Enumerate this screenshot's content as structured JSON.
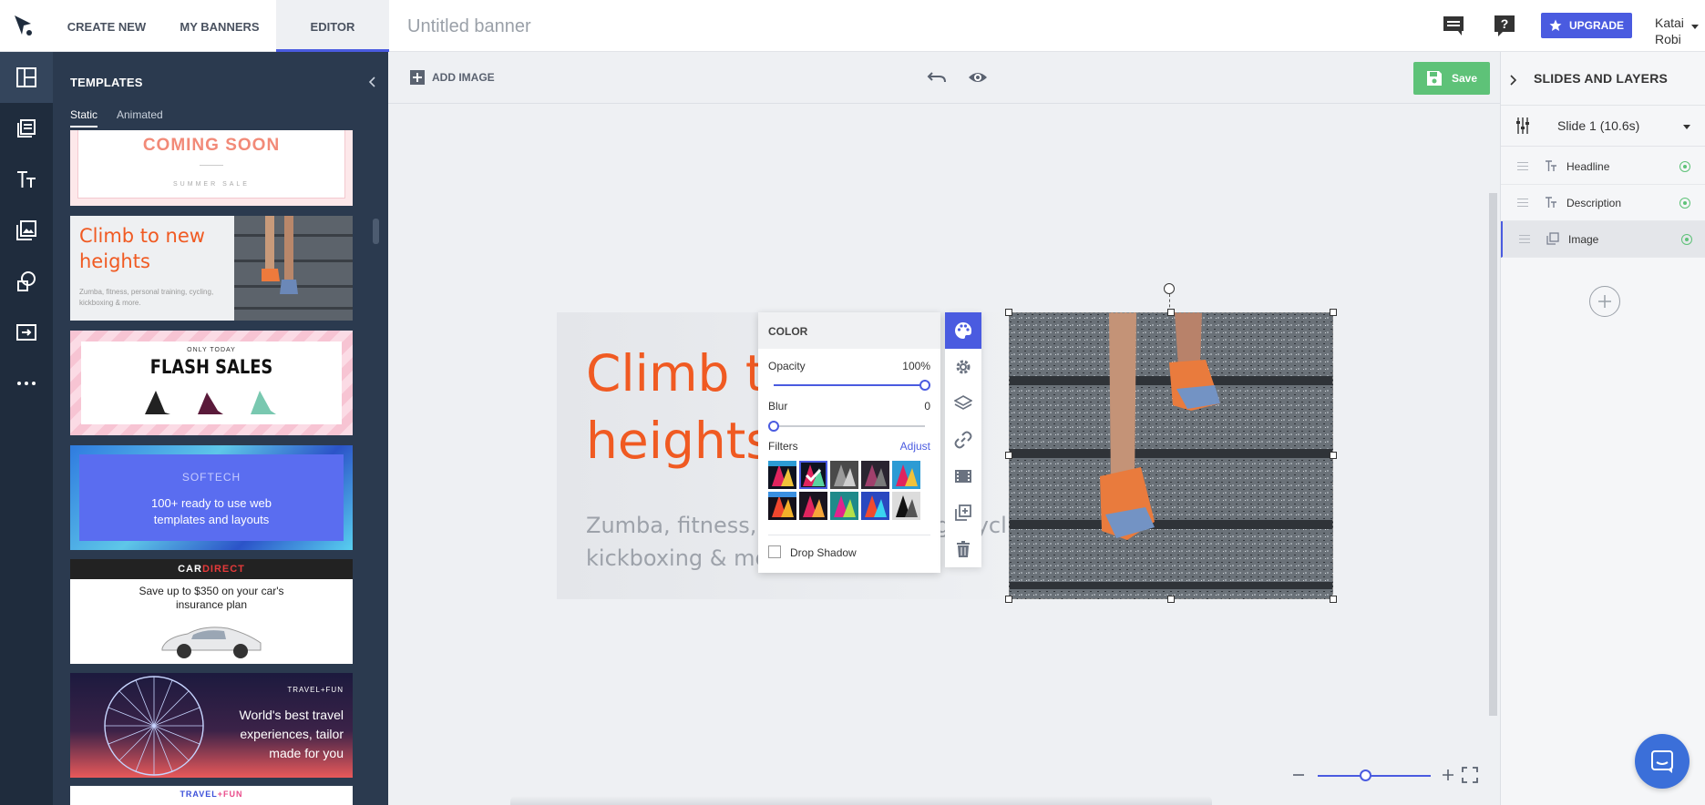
{
  "nav": {
    "tabs": [
      {
        "label": "CREATE NEW"
      },
      {
        "label": "MY BANNERS"
      },
      {
        "label": "EDITOR"
      }
    ],
    "doc_title": "Untitled banner",
    "upgrade_label": "UPGRADE",
    "user": {
      "first": "Katai",
      "last": "Robi"
    }
  },
  "templates": {
    "title": "TEMPLATES",
    "tabs": [
      "Static",
      "Animated"
    ],
    "cards": [
      {
        "headline": "COMING SOON",
        "sub": "SUMMER SALE"
      },
      {
        "headline": "Climb to new heights",
        "sub": "Zumba, fitness, personal training, cycling, kickboxing & more."
      },
      {
        "kicker": "ONLY TODAY",
        "headline": "FLASH SALES"
      },
      {
        "kicker": "SOFTECH",
        "headline": "100+ ready to use web templates and layouts"
      },
      {
        "brand_a": "CAR",
        "brand_b": "DIRECT",
        "headline": "Save up to $350 on your car's insurance plan"
      },
      {
        "brand_a": "TRAVEL",
        "brand_b": "+FUN",
        "headline": "World's best travel experiences, tailor made for you"
      },
      {
        "brand_a": "TRAVEL",
        "brand_b": "+FUN"
      }
    ]
  },
  "toolbar": {
    "add_image": "ADD IMAGE",
    "save": "Save"
  },
  "canvas": {
    "headline": "Climb to new heights",
    "description": "Zumba, fitness, personal training, cycling, kickboxing & more."
  },
  "color_panel": {
    "title": "COLOR",
    "opacity_label": "Opacity",
    "opacity_value": "100%",
    "opacity_level": 1.0,
    "blur_label": "Blur",
    "blur_value": "0",
    "blur_level": 0,
    "filters_label": "Filters",
    "adjust_label": "Adjust",
    "drop_shadow_label": "Drop Shadow"
  },
  "layers": {
    "title": "SLIDES AND LAYERS",
    "slide_label": "Slide 1 (10.6s)",
    "items": [
      {
        "name": "Headline"
      },
      {
        "name": "Description"
      },
      {
        "name": "Image"
      }
    ]
  },
  "zoom": {
    "level": 0.42
  },
  "colors": {
    "accent": "#4a5be0",
    "save_green": "#5ec278",
    "headline_orange": "#f05a22",
    "rail_bg": "#1f2c3d",
    "panel_bg": "#2b3a4f"
  }
}
